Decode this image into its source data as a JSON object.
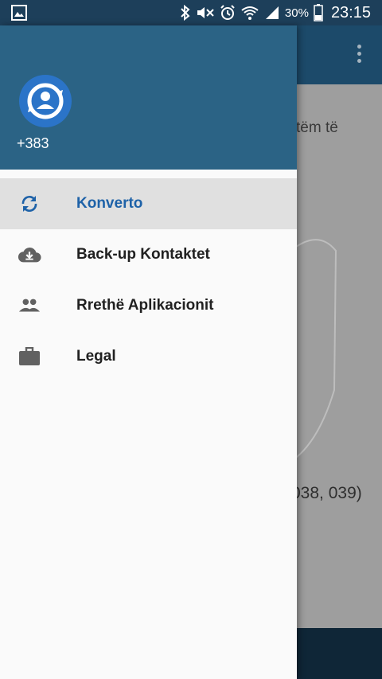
{
  "status_bar": {
    "battery_percent": "30%",
    "time": "23:15"
  },
  "background": {
    "text_partial_1": "tëm të",
    "text_partial_2": "038, 039)"
  },
  "drawer": {
    "phone_prefix": "+383",
    "items": [
      {
        "label": "Konverto",
        "icon": "sync-icon",
        "active": true
      },
      {
        "label": "Back-up Kontaktet",
        "icon": "cloud-download-icon",
        "active": false
      },
      {
        "label": "Rrethë Aplikacionit",
        "icon": "people-icon",
        "active": false
      },
      {
        "label": "Legal",
        "icon": "briefcase-icon",
        "active": false
      }
    ]
  },
  "colors": {
    "header": "#2b6385",
    "accent": "#1e62a8",
    "active_row": "#e0e0e0"
  }
}
